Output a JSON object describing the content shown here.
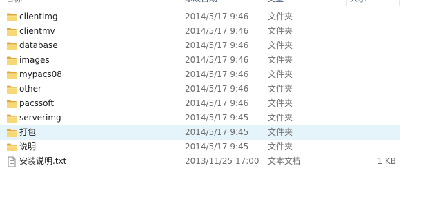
{
  "header": {
    "name_label": "名称",
    "date_label": "修改日期",
    "type_label": "类型",
    "size_label": "大小"
  },
  "files": [
    {
      "name": "clientimg",
      "date": "2014/5/17 9:46",
      "type": "文件夹",
      "size": "",
      "icon": "folder-icon"
    },
    {
      "name": "clientmv",
      "date": "2014/5/17 9:46",
      "type": "文件夹",
      "size": "",
      "icon": "folder-icon"
    },
    {
      "name": "database",
      "date": "2014/5/17 9:46",
      "type": "文件夹",
      "size": "",
      "icon": "folder-icon"
    },
    {
      "name": "images",
      "date": "2014/5/17 9:46",
      "type": "文件夹",
      "size": "",
      "icon": "folder-icon"
    },
    {
      "name": "mypacs08",
      "date": "2014/5/17 9:46",
      "type": "文件夹",
      "size": "",
      "icon": "folder-icon"
    },
    {
      "name": "other",
      "date": "2014/5/17 9:46",
      "type": "文件夹",
      "size": "",
      "icon": "folder-icon"
    },
    {
      "name": "pacssoft",
      "date": "2014/5/17 9:46",
      "type": "文件夹",
      "size": "",
      "icon": "folder-icon"
    },
    {
      "name": "serverimg",
      "date": "2014/5/17 9:45",
      "type": "文件夹",
      "size": "",
      "icon": "folder-icon"
    },
    {
      "name": "打包",
      "date": "2014/5/17 9:45",
      "type": "文件夹",
      "size": "",
      "icon": "folder-icon",
      "hovered": true
    },
    {
      "name": "说明",
      "date": "2014/5/17 9:45",
      "type": "文件夹",
      "size": "",
      "icon": "folder-icon"
    },
    {
      "name": "安装说明.txt",
      "date": "2013/11/25 17:00",
      "type": "文本文档",
      "size": "1 KB",
      "icon": "text-file-icon"
    }
  ],
  "colors": {
    "hover_background": "#e5f3fb",
    "folder_yellow": "#f8d775",
    "folder_dark": "#e0a93a"
  }
}
